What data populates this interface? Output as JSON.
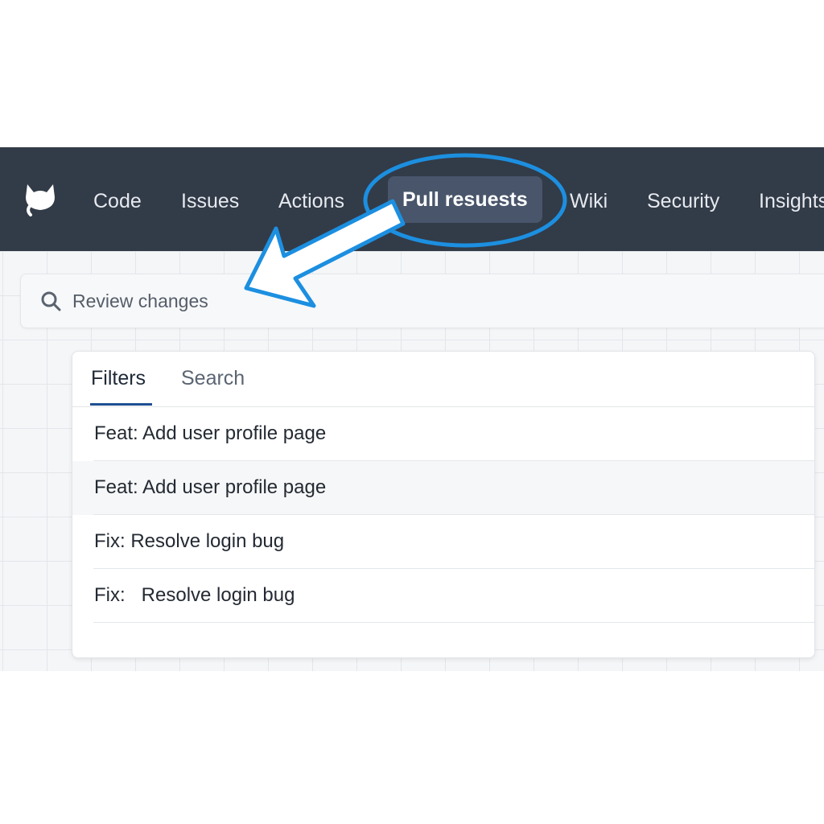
{
  "nav": {
    "items": [
      {
        "label": "Code"
      },
      {
        "label": "Issues"
      },
      {
        "label": "Actions"
      },
      {
        "label": "Pull resuests",
        "active": true
      },
      {
        "label": "Wiki"
      },
      {
        "label": "Security"
      },
      {
        "label": "Insights"
      }
    ]
  },
  "search": {
    "icon": "search-icon",
    "text": "Review changes"
  },
  "panel": {
    "tabs": [
      {
        "label": "Filters",
        "active": true
      },
      {
        "label": "Search"
      }
    ],
    "rows": [
      {
        "label": "Feat: Add user profile page"
      },
      {
        "label": "Feat: Add user profile page"
      },
      {
        "label": "Fix: Resolve login bug"
      },
      {
        "label": "Fix:   Resolve login bug"
      }
    ]
  },
  "colors": {
    "navbar": "#323b48",
    "active_tab_bg": "#48556a",
    "annotation_blue": "#1c8fe0",
    "tab_underline": "#1f4f91"
  }
}
